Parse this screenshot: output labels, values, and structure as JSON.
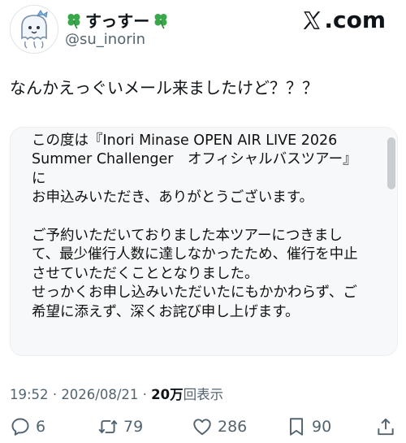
{
  "header": {
    "display_name": "すっすー",
    "name_icon": "four-leaf-clover-icon",
    "handle": "@su_inorin",
    "brand_text": ".com",
    "brand_icon": "x-logo-icon"
  },
  "tweet": {
    "text": "なんかえっぐいメール来ましたけど？？？"
  },
  "image_text": {
    "lines": [
      "この度は『Inori Minase OPEN AIR LIVE 2026",
      "Summer Challenger　オフィシャルバスツアー』",
      "に",
      "お申込みいただき、ありがとうございます。",
      "",
      "ご予約いただいておりました本ツアーにつきまし",
      "て、最少催行人数に達しなかったため、催行を中止",
      "させていただくこととなりました。",
      "せっかくお申し込みいただいたにもかかわらず、ご",
      "希望に添えず、深くお詫び申し上げます。"
    ]
  },
  "meta": {
    "time": "19:52",
    "separator": "·",
    "date": "2026/08/21",
    "views_count": "20万",
    "views_label": "回表示"
  },
  "actions": {
    "replies": "6",
    "reposts": "79",
    "likes": "286",
    "bookmarks": "90"
  },
  "colors": {
    "text": "#0f1419",
    "secondary": "#536471",
    "card_background": "#f7f8f9",
    "clover_green": "#3aa84a"
  }
}
